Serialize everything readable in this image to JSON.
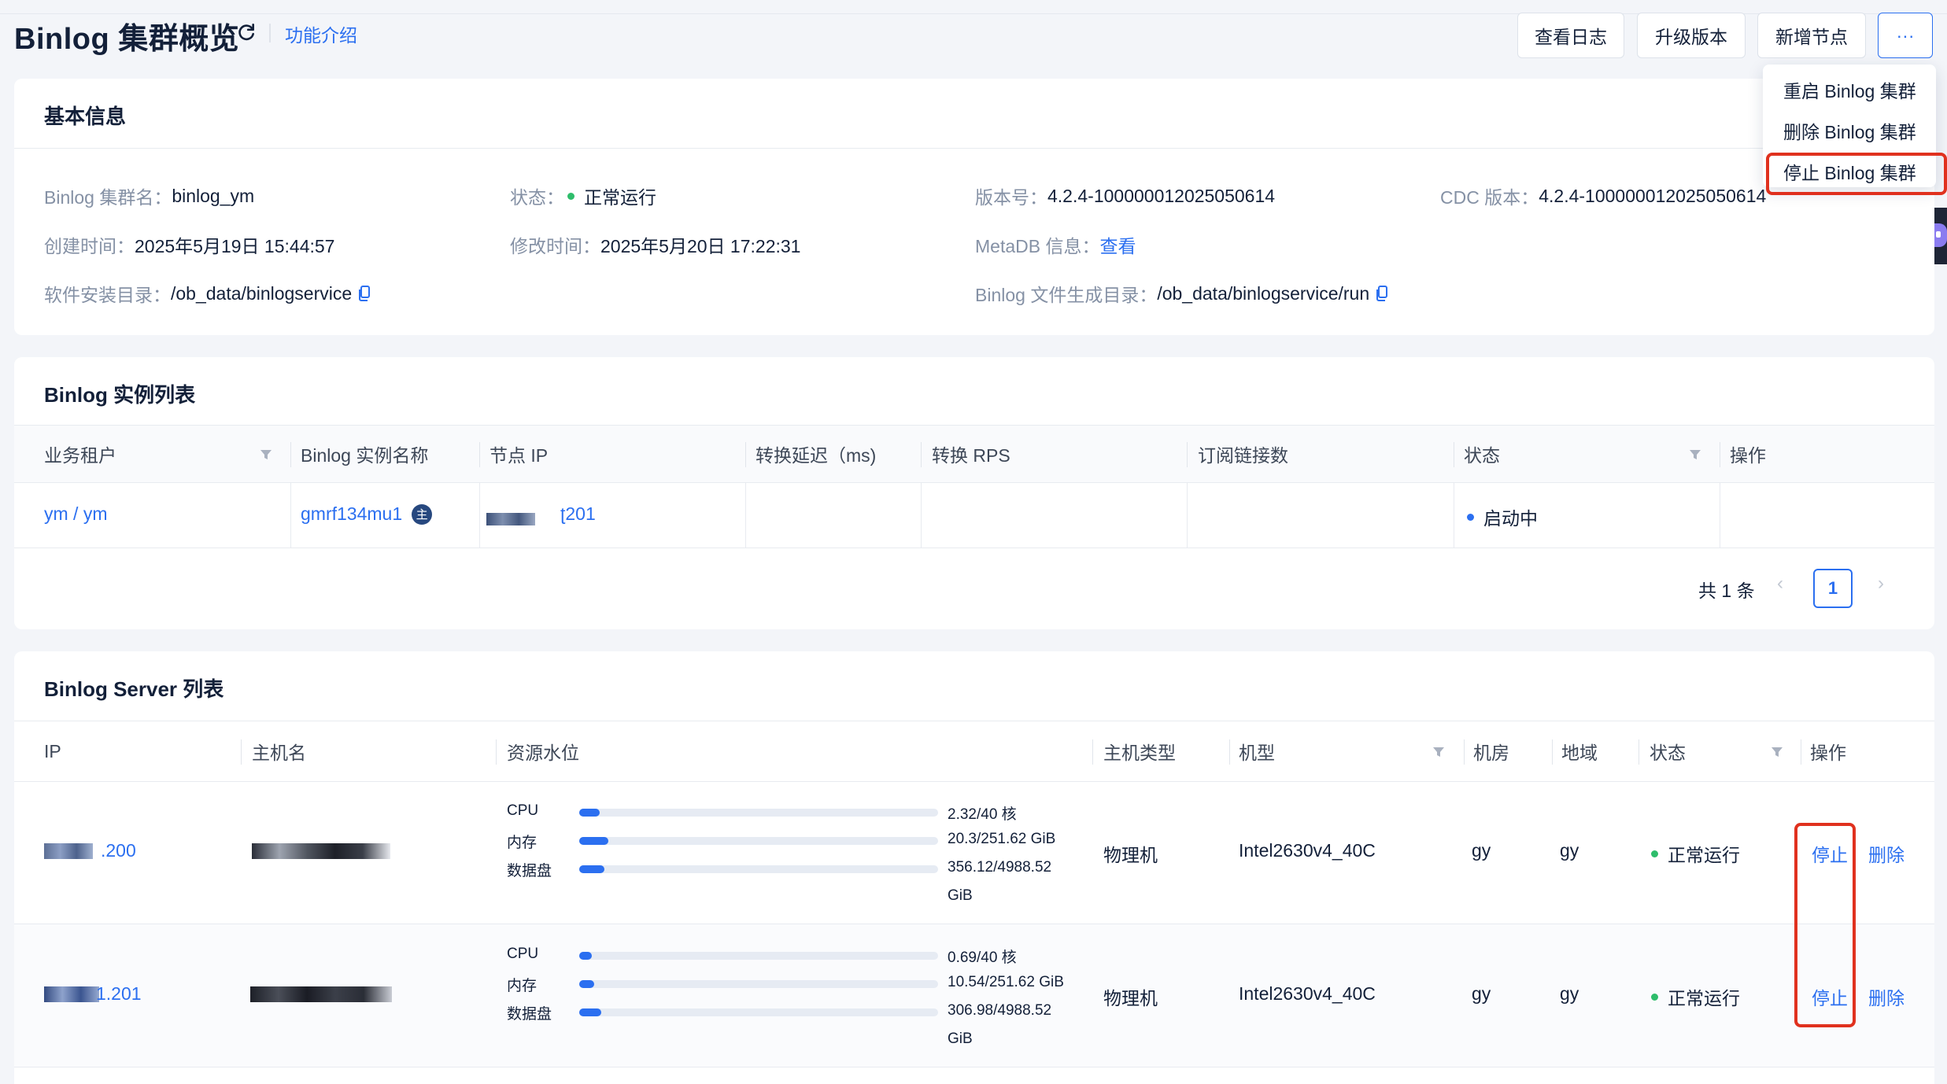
{
  "header": {
    "title": "Binlog 集群概览",
    "intro_link": "功能介绍",
    "buttons": {
      "view_logs": "查看日志",
      "upgrade": "升级版本",
      "add_node": "新增节点",
      "more": "···"
    }
  },
  "more_menu": {
    "items": [
      "重启 Binlog 集群",
      "删除 Binlog 集群",
      "停止 Binlog 集群"
    ],
    "highlighted_index": 2
  },
  "basic_info": {
    "title": "基本信息",
    "cluster_name_label": "Binlog 集群名：",
    "cluster_name": "binlog_ym",
    "status_label": "状态：",
    "status": "正常运行",
    "version_label": "版本号：",
    "version": "4.2.4-100000012025050614",
    "cdc_version_label": "CDC 版本：",
    "cdc_version": "4.2.4-100000012025050614",
    "created_label": "创建时间：",
    "created": "2025年5月19日 15:44:57",
    "modified_label": "修改时间：",
    "modified": "2025年5月20日 17:22:31",
    "metadb_label": "MetaDB 信息：",
    "metadb_link": "查看",
    "install_dir_label": "软件安装目录：",
    "install_dir": "/ob_data/binlogservice",
    "binlog_dir_label": "Binlog 文件生成目录：",
    "binlog_dir": "/ob_data/binlogservice/run"
  },
  "instance_list": {
    "title": "Binlog 实例列表",
    "columns": [
      "业务租户",
      "Binlog 实例名称",
      "节点 IP",
      "转换延迟（ms)",
      "转换 RPS",
      "订阅链接数",
      "状态",
      "操作"
    ],
    "rows": [
      {
        "tenant": "ym / ym",
        "instance": "gmrf134mu1",
        "node_ip_suffix": "ʈ201",
        "delay": "",
        "rps": "",
        "subs": "",
        "status": "启动中"
      }
    ],
    "pagination": {
      "total": "共 1 条",
      "page": "1",
      "prev": "‹",
      "next": "›"
    }
  },
  "server_list": {
    "title": "Binlog Server 列表",
    "columns": [
      "IP",
      "主机名",
      "资源水位",
      "主机类型",
      "机型",
      "机房",
      "地域",
      "状态",
      "操作"
    ],
    "rows": [
      {
        "ip_suffix": ".200",
        "resources": [
          {
            "label": "CPU",
            "value": "2.32/40 核",
            "ratio": 0.058
          },
          {
            "label": "内存",
            "value": "20.3/251.62 GiB",
            "ratio": 0.081
          },
          {
            "label": "数据盘",
            "value": "356.12/4988.52",
            "ratio": 0.071
          }
        ],
        "disk_unit": "GiB",
        "host_type": "物理机",
        "model": "Intel2630v4_40C",
        "room": "gy",
        "region": "gy",
        "status": "正常运行",
        "op_stop": "停止",
        "op_delete": "删除"
      },
      {
        "ip_suffix": "1.201",
        "resources": [
          {
            "label": "CPU",
            "value": "0.69/40 核",
            "ratio": 0.017
          },
          {
            "label": "内存",
            "value": "10.54/251.62 GiB",
            "ratio": 0.042
          },
          {
            "label": "数据盘",
            "value": "306.98/4988.52",
            "ratio": 0.062
          }
        ],
        "disk_unit": "GiB",
        "host_type": "物理机",
        "model": "Intel2630v4_40C",
        "room": "gy",
        "region": "gy",
        "status": "正常运行",
        "op_stop": "停止",
        "op_delete": "删除"
      }
    ]
  },
  "colors": {
    "accent": "#2b6ff0",
    "success": "#2ebd6b",
    "highlight": "#e0311e"
  }
}
